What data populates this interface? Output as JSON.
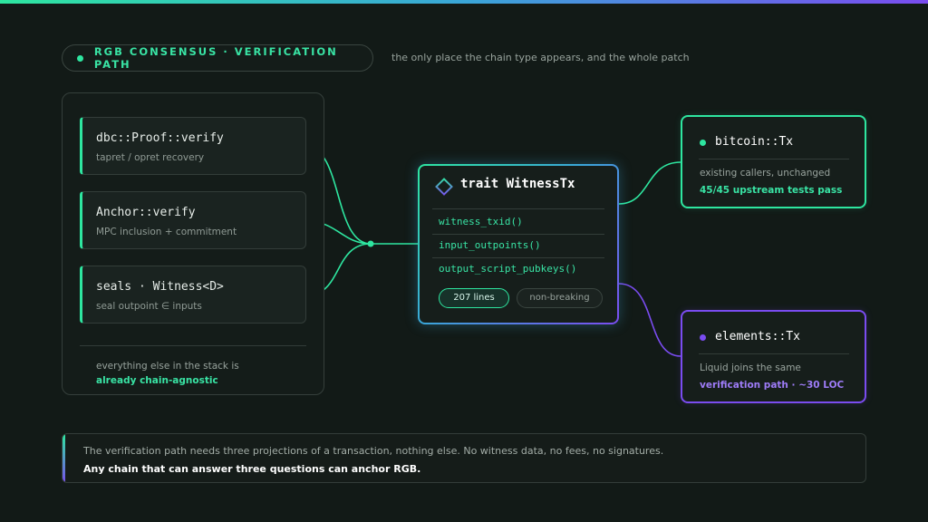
{
  "colors": {
    "accent_green": "#2ee6a0",
    "accent_purple": "#7a4cf0",
    "accent_blue": "#3aa6d8",
    "background": "#121a17"
  },
  "header": {
    "label": "RGB CONSENSUS · VERIFICATION PATH",
    "note": "the only place the chain type appears, and the whole patch"
  },
  "sources": [
    {
      "title": "dbc::Proof::verify",
      "subtitle": "tapret / opret recovery"
    },
    {
      "title": "Anchor::verify",
      "subtitle": "MPC inclusion + commitment"
    },
    {
      "title": "seals · Witness<D>",
      "subtitle": "seal outpoint ∈ inputs"
    }
  ],
  "left_footer": {
    "line1": "everything else in the stack is",
    "line2": "already chain-agnostic"
  },
  "trait": {
    "icon": "diamond-icon",
    "title": "trait WitnessTx",
    "methods": [
      "witness_txid()",
      "input_outpoints()",
      "output_script_pubkeys()"
    ],
    "badge_lines": "207 lines",
    "badge_status": "non-breaking"
  },
  "targets": {
    "bitcoin": {
      "name": "bitcoin::Tx",
      "line1": "existing callers, unchanged",
      "line2": "45/45 upstream tests pass"
    },
    "elements": {
      "name": "elements::Tx",
      "line1": "Liquid joins the same",
      "line2": "verification path · ~30 LOC"
    }
  },
  "footer": {
    "line1": "The verification path needs three projections of a transaction, nothing else. No witness data, no fees, no signatures.",
    "line2": "Any chain that can answer three questions can anchor RGB."
  }
}
